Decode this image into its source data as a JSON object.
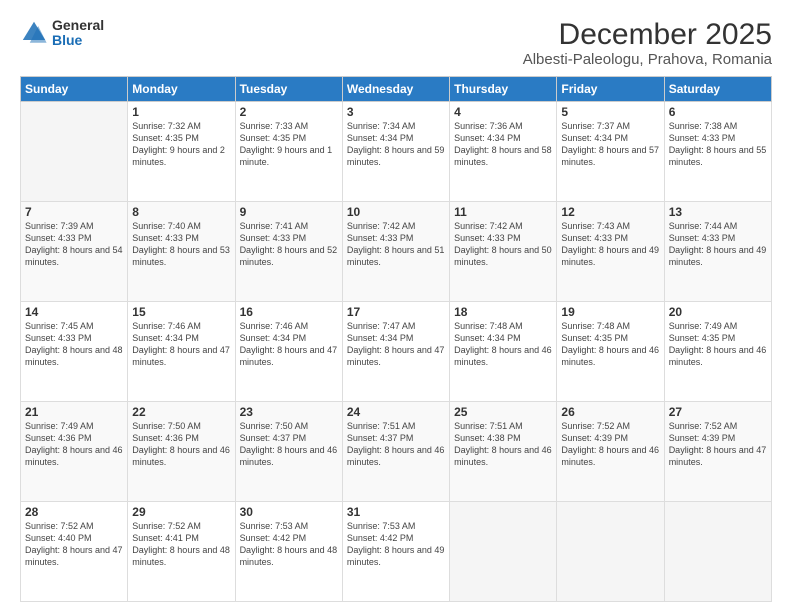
{
  "logo": {
    "general": "General",
    "blue": "Blue"
  },
  "header": {
    "title": "December 2025",
    "subtitle": "Albesti-Paleologu, Prahova, Romania"
  },
  "days_of_week": [
    "Sunday",
    "Monday",
    "Tuesday",
    "Wednesday",
    "Thursday",
    "Friday",
    "Saturday"
  ],
  "weeks": [
    [
      {
        "day": "",
        "sunrise": "",
        "sunset": "",
        "daylight": ""
      },
      {
        "day": "1",
        "sunrise": "Sunrise: 7:32 AM",
        "sunset": "Sunset: 4:35 PM",
        "daylight": "Daylight: 9 hours and 2 minutes."
      },
      {
        "day": "2",
        "sunrise": "Sunrise: 7:33 AM",
        "sunset": "Sunset: 4:35 PM",
        "daylight": "Daylight: 9 hours and 1 minute."
      },
      {
        "day": "3",
        "sunrise": "Sunrise: 7:34 AM",
        "sunset": "Sunset: 4:34 PM",
        "daylight": "Daylight: 8 hours and 59 minutes."
      },
      {
        "day": "4",
        "sunrise": "Sunrise: 7:36 AM",
        "sunset": "Sunset: 4:34 PM",
        "daylight": "Daylight: 8 hours and 58 minutes."
      },
      {
        "day": "5",
        "sunrise": "Sunrise: 7:37 AM",
        "sunset": "Sunset: 4:34 PM",
        "daylight": "Daylight: 8 hours and 57 minutes."
      },
      {
        "day": "6",
        "sunrise": "Sunrise: 7:38 AM",
        "sunset": "Sunset: 4:33 PM",
        "daylight": "Daylight: 8 hours and 55 minutes."
      }
    ],
    [
      {
        "day": "7",
        "sunrise": "Sunrise: 7:39 AM",
        "sunset": "Sunset: 4:33 PM",
        "daylight": "Daylight: 8 hours and 54 minutes."
      },
      {
        "day": "8",
        "sunrise": "Sunrise: 7:40 AM",
        "sunset": "Sunset: 4:33 PM",
        "daylight": "Daylight: 8 hours and 53 minutes."
      },
      {
        "day": "9",
        "sunrise": "Sunrise: 7:41 AM",
        "sunset": "Sunset: 4:33 PM",
        "daylight": "Daylight: 8 hours and 52 minutes."
      },
      {
        "day": "10",
        "sunrise": "Sunrise: 7:42 AM",
        "sunset": "Sunset: 4:33 PM",
        "daylight": "Daylight: 8 hours and 51 minutes."
      },
      {
        "day": "11",
        "sunrise": "Sunrise: 7:42 AM",
        "sunset": "Sunset: 4:33 PM",
        "daylight": "Daylight: 8 hours and 50 minutes."
      },
      {
        "day": "12",
        "sunrise": "Sunrise: 7:43 AM",
        "sunset": "Sunset: 4:33 PM",
        "daylight": "Daylight: 8 hours and 49 minutes."
      },
      {
        "day": "13",
        "sunrise": "Sunrise: 7:44 AM",
        "sunset": "Sunset: 4:33 PM",
        "daylight": "Daylight: 8 hours and 49 minutes."
      }
    ],
    [
      {
        "day": "14",
        "sunrise": "Sunrise: 7:45 AM",
        "sunset": "Sunset: 4:33 PM",
        "daylight": "Daylight: 8 hours and 48 minutes."
      },
      {
        "day": "15",
        "sunrise": "Sunrise: 7:46 AM",
        "sunset": "Sunset: 4:34 PM",
        "daylight": "Daylight: 8 hours and 47 minutes."
      },
      {
        "day": "16",
        "sunrise": "Sunrise: 7:46 AM",
        "sunset": "Sunset: 4:34 PM",
        "daylight": "Daylight: 8 hours and 47 minutes."
      },
      {
        "day": "17",
        "sunrise": "Sunrise: 7:47 AM",
        "sunset": "Sunset: 4:34 PM",
        "daylight": "Daylight: 8 hours and 47 minutes."
      },
      {
        "day": "18",
        "sunrise": "Sunrise: 7:48 AM",
        "sunset": "Sunset: 4:34 PM",
        "daylight": "Daylight: 8 hours and 46 minutes."
      },
      {
        "day": "19",
        "sunrise": "Sunrise: 7:48 AM",
        "sunset": "Sunset: 4:35 PM",
        "daylight": "Daylight: 8 hours and 46 minutes."
      },
      {
        "day": "20",
        "sunrise": "Sunrise: 7:49 AM",
        "sunset": "Sunset: 4:35 PM",
        "daylight": "Daylight: 8 hours and 46 minutes."
      }
    ],
    [
      {
        "day": "21",
        "sunrise": "Sunrise: 7:49 AM",
        "sunset": "Sunset: 4:36 PM",
        "daylight": "Daylight: 8 hours and 46 minutes."
      },
      {
        "day": "22",
        "sunrise": "Sunrise: 7:50 AM",
        "sunset": "Sunset: 4:36 PM",
        "daylight": "Daylight: 8 hours and 46 minutes."
      },
      {
        "day": "23",
        "sunrise": "Sunrise: 7:50 AM",
        "sunset": "Sunset: 4:37 PM",
        "daylight": "Daylight: 8 hours and 46 minutes."
      },
      {
        "day": "24",
        "sunrise": "Sunrise: 7:51 AM",
        "sunset": "Sunset: 4:37 PM",
        "daylight": "Daylight: 8 hours and 46 minutes."
      },
      {
        "day": "25",
        "sunrise": "Sunrise: 7:51 AM",
        "sunset": "Sunset: 4:38 PM",
        "daylight": "Daylight: 8 hours and 46 minutes."
      },
      {
        "day": "26",
        "sunrise": "Sunrise: 7:52 AM",
        "sunset": "Sunset: 4:39 PM",
        "daylight": "Daylight: 8 hours and 46 minutes."
      },
      {
        "day": "27",
        "sunrise": "Sunrise: 7:52 AM",
        "sunset": "Sunset: 4:39 PM",
        "daylight": "Daylight: 8 hours and 47 minutes."
      }
    ],
    [
      {
        "day": "28",
        "sunrise": "Sunrise: 7:52 AM",
        "sunset": "Sunset: 4:40 PM",
        "daylight": "Daylight: 8 hours and 47 minutes."
      },
      {
        "day": "29",
        "sunrise": "Sunrise: 7:52 AM",
        "sunset": "Sunset: 4:41 PM",
        "daylight": "Daylight: 8 hours and 48 minutes."
      },
      {
        "day": "30",
        "sunrise": "Sunrise: 7:53 AM",
        "sunset": "Sunset: 4:42 PM",
        "daylight": "Daylight: 8 hours and 48 minutes."
      },
      {
        "day": "31",
        "sunrise": "Sunrise: 7:53 AM",
        "sunset": "Sunset: 4:42 PM",
        "daylight": "Daylight: 8 hours and 49 minutes."
      },
      {
        "day": "",
        "sunrise": "",
        "sunset": "",
        "daylight": ""
      },
      {
        "day": "",
        "sunrise": "",
        "sunset": "",
        "daylight": ""
      },
      {
        "day": "",
        "sunrise": "",
        "sunset": "",
        "daylight": ""
      }
    ]
  ]
}
